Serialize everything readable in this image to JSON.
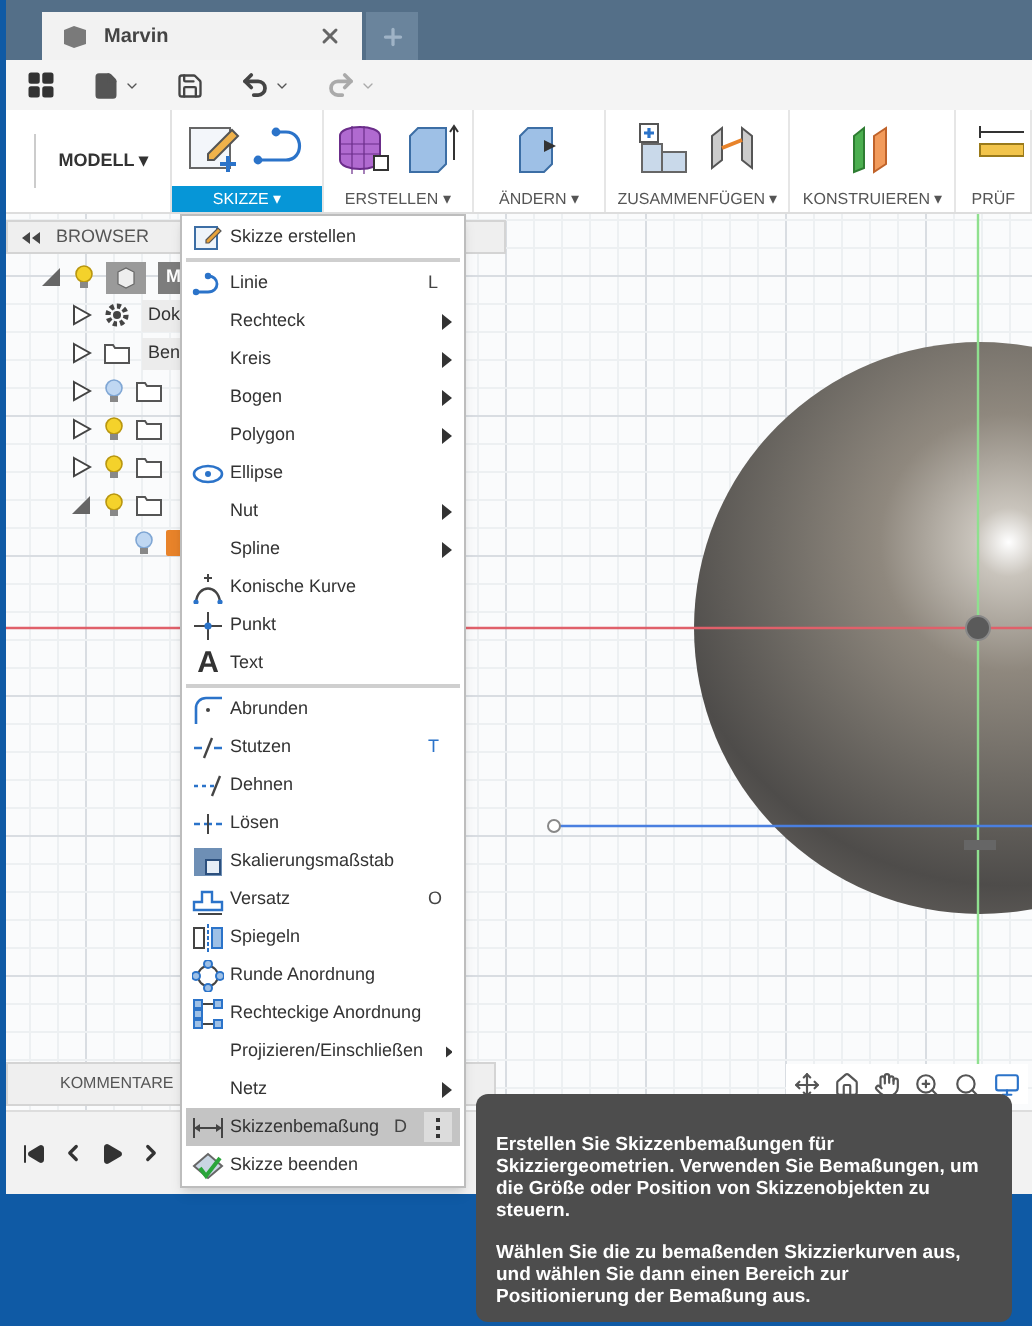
{
  "tab": {
    "title": "Marvin"
  },
  "ribbon": {
    "workspace": "MODELL ▾",
    "groups": [
      {
        "label": "SKIZZE ▾",
        "selected": true
      },
      {
        "label": "ERSTELLEN ▾",
        "selected": false
      },
      {
        "label": "ÄNDERN ▾",
        "selected": false
      },
      {
        "label": "ZUSAMMENFÜGEN ▾",
        "selected": false
      },
      {
        "label": "KONSTRUIEREN ▾",
        "selected": false
      },
      {
        "label": "PRÜF",
        "selected": false
      }
    ]
  },
  "browser": {
    "title": "BROWSER",
    "tree": [
      {
        "kind": "component",
        "label": "M",
        "expanded": true,
        "visible": true,
        "children": [
          {
            "kind": "settings",
            "label": "Dok",
            "expanded": false
          },
          {
            "kind": "folder",
            "label": "Ben",
            "expanded": false
          },
          {
            "kind": "folder",
            "expanded": false,
            "visible": false
          },
          {
            "kind": "folder",
            "expanded": false,
            "visible": true
          },
          {
            "kind": "folder",
            "expanded": false,
            "visible": true
          },
          {
            "kind": "folder",
            "expanded": true,
            "visible": true,
            "children": [
              {
                "kind": "body",
                "visible": false
              }
            ]
          }
        ]
      }
    ]
  },
  "menu": {
    "sections": [
      [
        {
          "label": "Skizze erstellen",
          "selected": false
        }
      ],
      [
        {
          "label": "Linie",
          "shortcut": "L",
          "selected": false
        },
        {
          "label": "Rechteck",
          "submenu": true,
          "selected": false
        },
        {
          "label": "Kreis",
          "submenu": true,
          "selected": false
        },
        {
          "label": "Bogen",
          "submenu": true,
          "selected": false
        },
        {
          "label": "Polygon",
          "submenu": true,
          "selected": false
        },
        {
          "label": "Ellipse",
          "selected": false
        },
        {
          "label": "Nut",
          "submenu": true,
          "selected": false
        },
        {
          "label": "Spline",
          "submenu": true,
          "selected": false
        },
        {
          "label": "Konische Kurve",
          "selected": false
        },
        {
          "label": "Punkt",
          "selected": false
        },
        {
          "label": "Text",
          "glyph": "A",
          "selected": false
        }
      ],
      [
        {
          "label": "Abrunden",
          "selected": false
        },
        {
          "label": "Stutzen",
          "shortcut": "T",
          "selected": false
        },
        {
          "label": "Dehnen",
          "selected": false
        },
        {
          "label": "Lösen",
          "selected": false
        },
        {
          "label": "Skalierungsmaßstab",
          "selected": false
        },
        {
          "label": "Versatz",
          "shortcut": "O",
          "selected": false
        },
        {
          "label": "Spiegeln",
          "selected": false
        },
        {
          "label": "Runde Anordnung",
          "selected": false
        },
        {
          "label": "Rechteckige Anordnung",
          "selected": false
        },
        {
          "label": "Projizieren/Einschließen",
          "submenu": true,
          "selected": false
        },
        {
          "label": "Netz",
          "submenu": true,
          "selected": false
        },
        {
          "label": "Skizzenbemaßung",
          "shortcut": "D",
          "selected": true
        },
        {
          "label": "Skizze beenden",
          "selected": false
        }
      ]
    ]
  },
  "comments": {
    "title": "KOMMENTARE"
  },
  "tooltip": {
    "paragraphs": [
      "Erstellen Sie Skizzenbemaßungen für Skizziergeometrien. Verwenden Sie Bemaßungen, um die Größe oder Position von Skizzenobjekten zu steuern.",
      "Wählen Sie die zu bemaßenden Skizzierkurven aus, und wählen Sie dann einen Bereich zur Positionierung der Bemaßung aus."
    ]
  }
}
